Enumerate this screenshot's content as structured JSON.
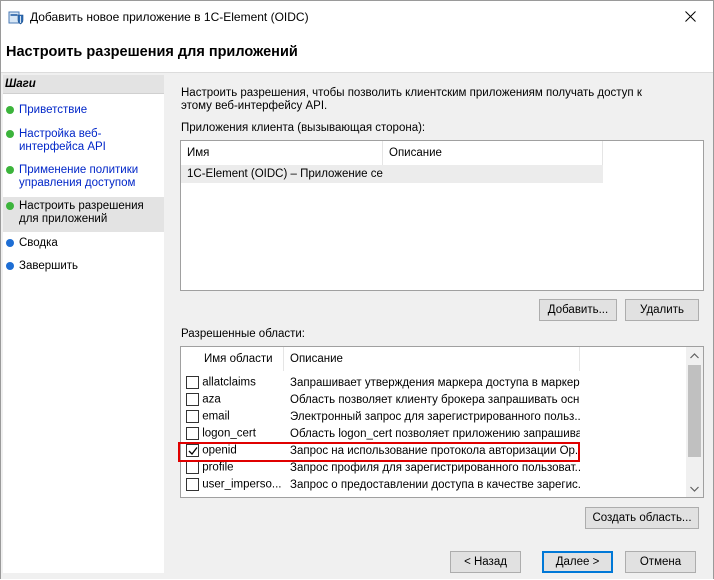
{
  "window": {
    "title": "Добавить новое приложение в 1C-Element (OIDC)"
  },
  "header": {
    "title": "Настроить разрешения для приложений"
  },
  "steps": {
    "title": "Шаги",
    "items": [
      {
        "label": "Приветствие",
        "state": "done"
      },
      {
        "label": "Настройка веб-интерфейса API",
        "state": "done"
      },
      {
        "label": "Применение политики управления доступом",
        "state": "done"
      },
      {
        "label": "Настроить разрешения для приложений",
        "state": "current"
      },
      {
        "label": "Сводка",
        "state": "pending"
      },
      {
        "label": "Завершить",
        "state": "pending"
      }
    ]
  },
  "main": {
    "description": "Настроить разрешения, чтобы позволить клиентским приложениям получать доступ к этому веб-интерфейсу API.",
    "clients_label": "Приложения клиента (вызывающая сторона):",
    "clients_columns": [
      "Имя",
      "Описание"
    ],
    "clients_rows": [
      {
        "name": "1C-Element (OIDC) – Приложение се...",
        "description": ""
      }
    ],
    "add_button": "Добавить...",
    "remove_button": "Удалить",
    "scopes_label": "Разрешенные области:",
    "scopes_columns": [
      "Имя области",
      "Описание"
    ],
    "scopes_rows": [
      {
        "name": "allatclaims",
        "description": "Запрашивает утверждения маркера доступа в маркер...",
        "checked": false
      },
      {
        "name": "aza",
        "description": "Область позволяет клиенту брокера запрашивать осн...",
        "checked": false
      },
      {
        "name": "email",
        "description": "Электронный запрос для зарегистрированного польз...",
        "checked": false
      },
      {
        "name": "logon_cert",
        "description": "Область logon_cert позволяет приложению запрашива...",
        "checked": false
      },
      {
        "name": "openid",
        "description": "Запрос на использование протокола авторизации Op...",
        "checked": true
      },
      {
        "name": "profile",
        "description": "Запрос профиля для зарегистрированного пользоват...",
        "checked": false
      },
      {
        "name": "user_imperso...",
        "description": "Запрос о предоставлении доступа в качестве зарегис...",
        "checked": false
      }
    ],
    "create_scope_button": "Создать область..."
  },
  "footer": {
    "back_button": "< Назад",
    "next_button": "Далее >",
    "cancel_button": "Отмена"
  },
  "colors": {
    "link": "#0026c8",
    "done_dot": "#3cb43c",
    "pending_dot": "#1e6ed4",
    "highlight": "#e00000",
    "primary_border": "#0078d7"
  }
}
